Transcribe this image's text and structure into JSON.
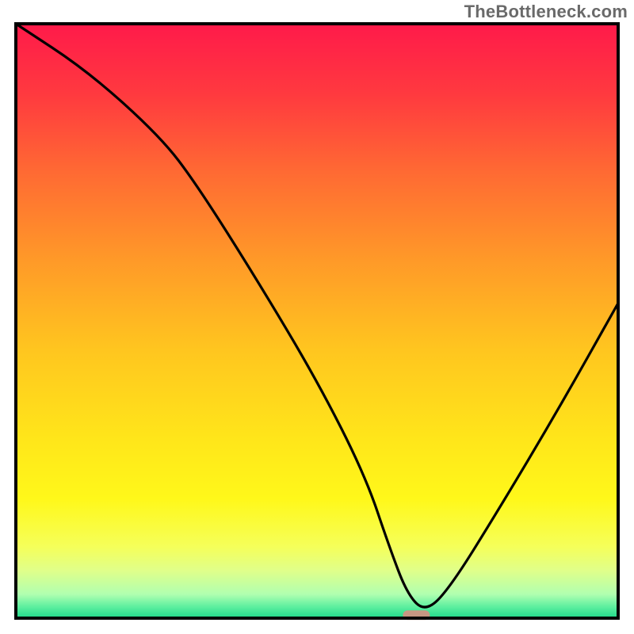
{
  "watermark": "TheBottleneck.com",
  "chart_data": {
    "type": "line",
    "title": "",
    "xlabel": "",
    "ylabel": "",
    "xlim": [
      0,
      100
    ],
    "ylim": [
      0,
      100
    ],
    "grid": false,
    "legend": false,
    "background": "gradient-red-to-green",
    "series": [
      {
        "name": "bottleneck-curve",
        "x": [
          0,
          12,
          24,
          30,
          40,
          50,
          58,
          62,
          65,
          68,
          72,
          80,
          90,
          100
        ],
        "values": [
          100,
          92,
          81,
          73,
          57,
          40,
          24,
          12,
          4,
          1,
          5,
          18,
          35,
          53
        ]
      }
    ],
    "marker": {
      "x": 66.5,
      "y": 0.5,
      "shape": "pill",
      "color": "#e08a80"
    }
  }
}
